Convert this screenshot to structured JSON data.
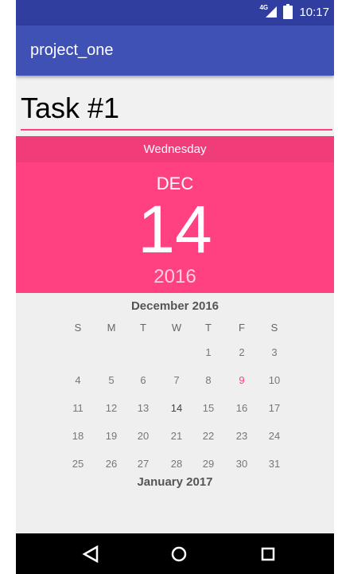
{
  "status_bar": {
    "network": "4G",
    "time": "10:17"
  },
  "app_bar": {
    "title": "project_one"
  },
  "task": {
    "value": "Task #1"
  },
  "date_header": {
    "weekday": "Wednesday",
    "month": "DEC",
    "day": "14",
    "year": "2016"
  },
  "calendar": {
    "month_title": "December 2016",
    "weekdays": [
      "S",
      "M",
      "T",
      "W",
      "T",
      "F",
      "S"
    ],
    "weeks": [
      [
        "",
        "",
        "",
        "",
        "1",
        "2",
        "3"
      ],
      [
        "4",
        "5",
        "6",
        "7",
        "8",
        "9",
        "10"
      ],
      [
        "11",
        "12",
        "13",
        "14",
        "15",
        "16",
        "17"
      ],
      [
        "18",
        "19",
        "20",
        "21",
        "22",
        "23",
        "24"
      ],
      [
        "25",
        "26",
        "27",
        "28",
        "29",
        "30",
        "31"
      ]
    ],
    "selected_day": "14",
    "today_highlight_day": "9",
    "next_month_title": "January 2017"
  },
  "colors": {
    "accent": "#ff4081",
    "primary": "#3f51b5",
    "primary_dark": "#303f9f"
  }
}
